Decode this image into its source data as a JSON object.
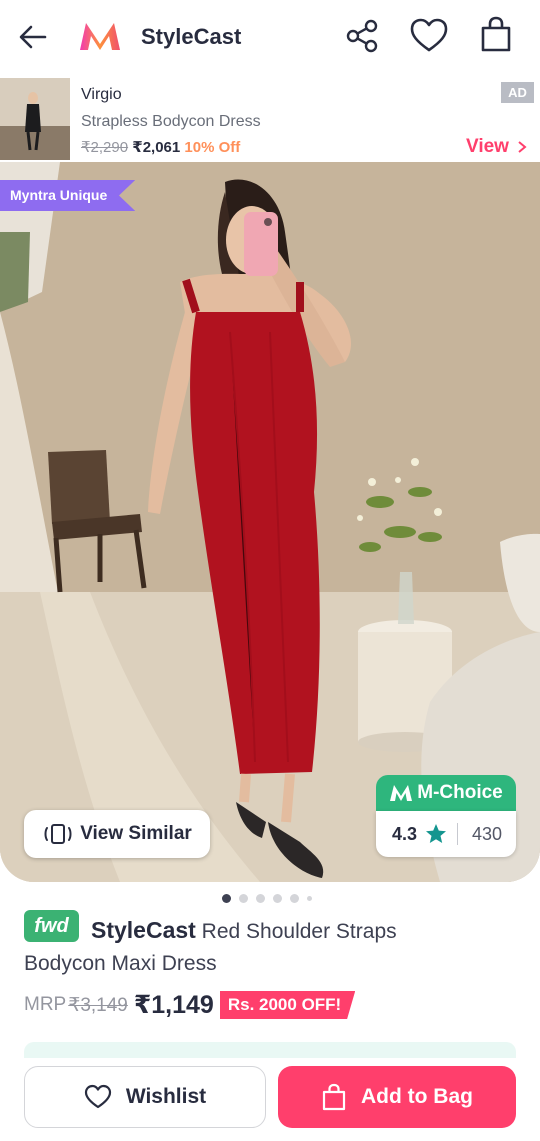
{
  "header": {
    "title": "StyleCast",
    "icons": [
      "back-arrow-icon",
      "myntra-logo",
      "share-icon",
      "heart-icon",
      "bag-icon"
    ]
  },
  "ad": {
    "brand": "Virgio",
    "name": "Strapless Bodycon Dress",
    "mrp": "₹2,290",
    "price": "₹2,061",
    "discount": "10% Off",
    "tag": "AD",
    "view_label": "View"
  },
  "hero": {
    "badge": "Myntra Unique",
    "view_similar": "View Similar",
    "mchoice": {
      "label": "M-Choice",
      "rating": "4.3",
      "count": "430"
    },
    "dots_total": 6,
    "dots_active": 0
  },
  "product": {
    "fwd_badge": "fwd",
    "brand": "StyleCast",
    "name": "Red Shoulder Straps Bodycon Maxi Dress",
    "mrp_label": "MRP",
    "mrp": "₹3,149",
    "price": "₹1,149",
    "offer": "Rs. 2000 OFF!"
  },
  "actions": {
    "wishlist": "Wishlist",
    "add_to_bag": "Add to Bag"
  },
  "colors": {
    "accent": "#ff3f6c",
    "mchoice_green": "#2eb67d",
    "badge_purple": "#8e6cf0",
    "discount_orange": "#ff905a"
  }
}
